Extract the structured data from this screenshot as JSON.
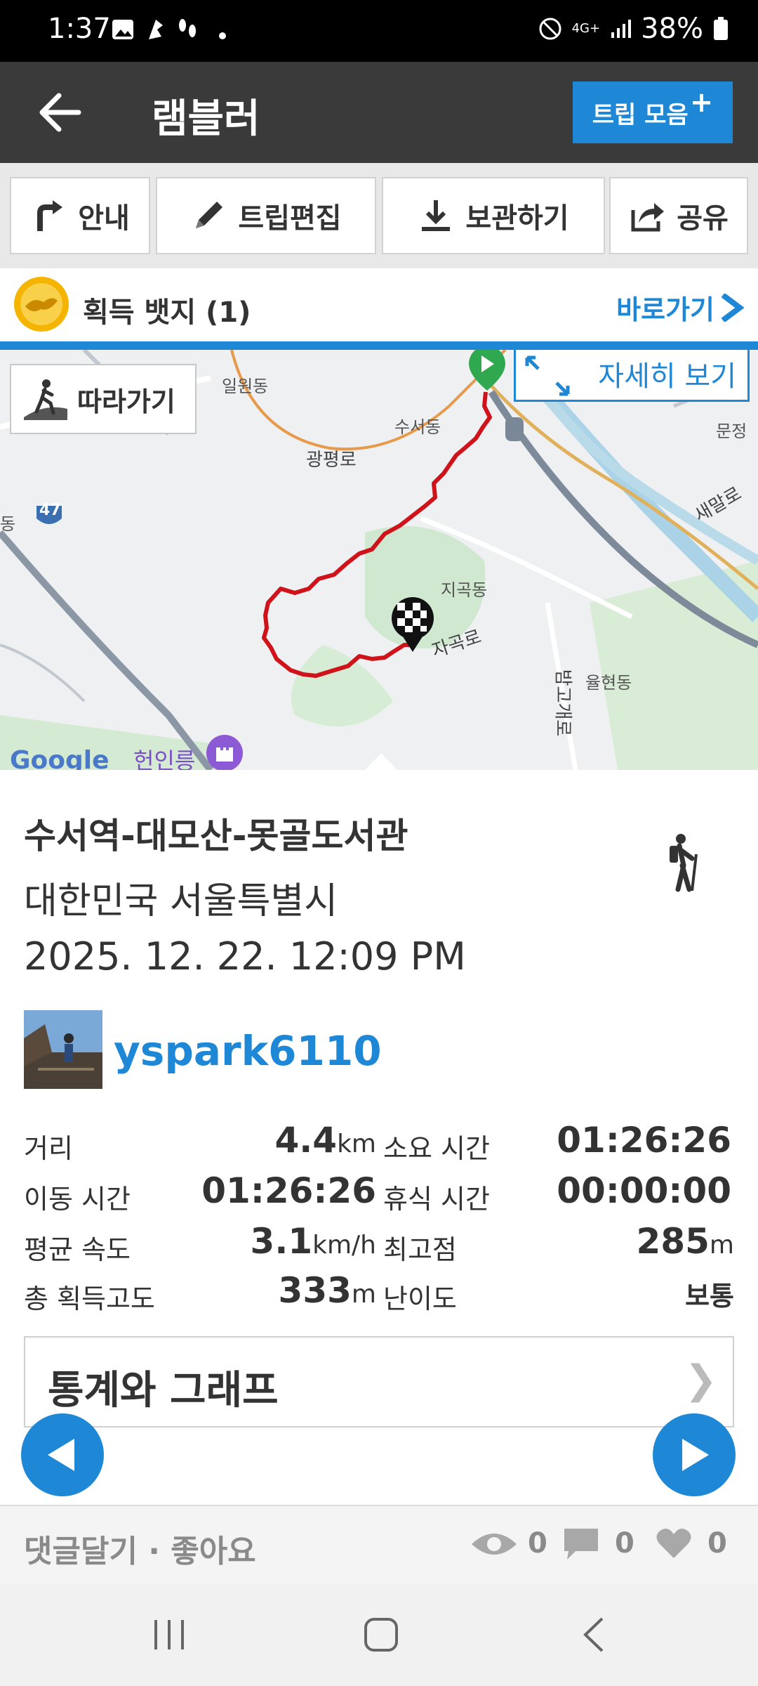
{
  "status_bar": {
    "time": "1:37",
    "network": "4G+",
    "battery": "38%"
  },
  "app_bar": {
    "title": "램블러",
    "trip_collection": "트립 모음",
    "trip_collection_plus": "+"
  },
  "toolbar": {
    "guide": "안내",
    "edit_trip": "트립편집",
    "save": "보관하기",
    "share": "공유"
  },
  "badge": {
    "label": "획득 뱃지 (1)",
    "goto": "바로가기"
  },
  "map": {
    "follow": "따라가기",
    "details": "자세히 보기",
    "labels": {
      "ilwon": "일원동",
      "suseo": "수서동",
      "gwangpyeong": "광평로",
      "munjeong": "문정",
      "saemal": "새말로",
      "dong": "동",
      "route47": "47",
      "jigok": "지곡동",
      "jagok": "자곡로",
      "bamgogae": "밤고개로",
      "yulhyeon": "율현동",
      "heoninneung": "헌인릉",
      "google": "Google"
    }
  },
  "trip": {
    "title": "수서역-대모산-못골도서관",
    "location": "대한민국 서울특별시",
    "date": "2025. 12. 22. 12:09 PM",
    "username": "yspark6110"
  },
  "stats": {
    "distance_label": "거리",
    "distance_value": "4.4",
    "distance_unit": "km",
    "duration_label": "소요 시간",
    "duration_value": "01:26:26",
    "moving_label": "이동 시간",
    "moving_value": "01:26:26",
    "rest_label": "휴식 시간",
    "rest_value": "00:00:00",
    "avg_speed_label": "평균 속도",
    "avg_speed_value": "3.1",
    "avg_speed_unit": "km/h",
    "max_alt_label": "최고점",
    "max_alt_value": "285",
    "max_alt_unit": "m",
    "gain_label": "총 획득고도",
    "gain_value": "333",
    "gain_unit": "m",
    "difficulty_label": "난이도",
    "difficulty_value": "보통"
  },
  "graphs": {
    "label": "통계와 그래프",
    "chevron": "❯"
  },
  "footer": {
    "comment_like": "댓글달기 · 좋아요",
    "views": "0",
    "comments": "0",
    "likes": "0"
  },
  "colors": {
    "accent": "#1e88d6",
    "route": "#d0121b",
    "start_marker": "#2fa84f"
  }
}
